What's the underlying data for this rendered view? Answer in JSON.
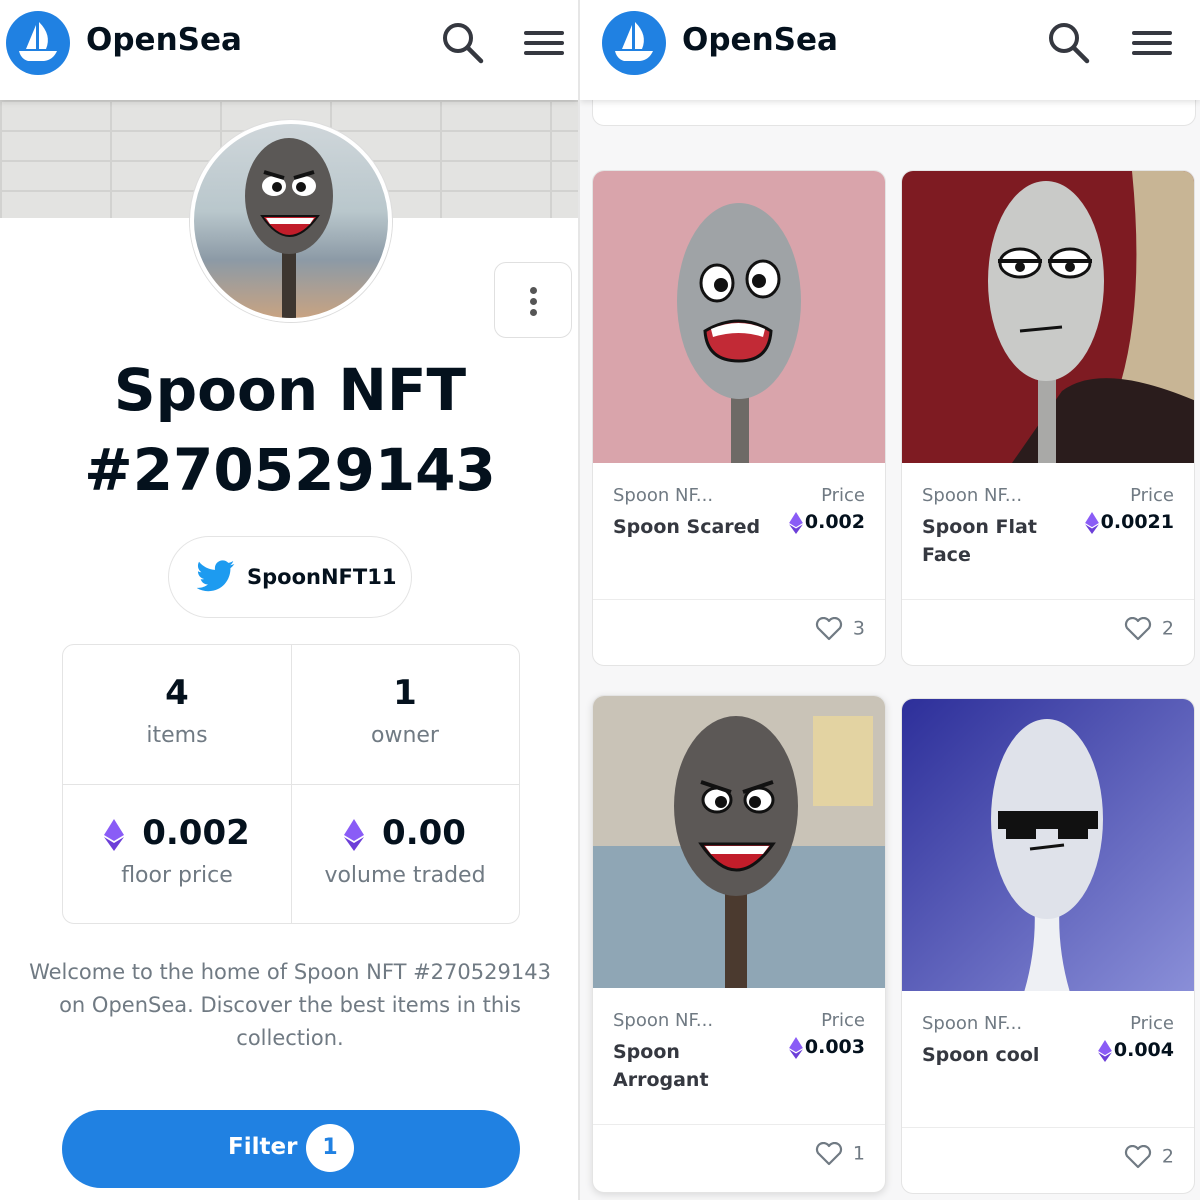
{
  "left": {
    "header": {
      "brand": "OpenSea"
    },
    "collection": {
      "title": "Spoon NFT #270529143",
      "twitter_handle": "SpoonNFT11",
      "stats": [
        {
          "value": "4",
          "label": "items"
        },
        {
          "value": "1",
          "label": "owner"
        },
        {
          "value": "0.002",
          "label": "floor price",
          "currency_icon": "ethereum-icon"
        },
        {
          "value": "0.00",
          "label": "volume traded",
          "currency_icon": "ethereum-icon"
        }
      ],
      "description": "Welcome to the home of Spoon NFT #270529143 on OpenSea. Discover the best items in this collection."
    },
    "filter": {
      "label": "Filter",
      "count": "1"
    }
  },
  "right": {
    "header": {
      "brand": "OpenSea"
    },
    "items": [
      {
        "collection": "Spoon NF...",
        "name": "Spoon Scared",
        "price_label": "Price",
        "price": "0.002",
        "likes": "3"
      },
      {
        "collection": "Spoon NF...",
        "name": "Spoon Flat Face",
        "price_label": "Price",
        "price": "0.0021",
        "likes": "2"
      },
      {
        "collection": "Spoon NF...",
        "name": "Spoon Arrogant",
        "price_label": "Price",
        "price": "0.003",
        "likes": "1"
      },
      {
        "collection": "Spoon NF...",
        "name": "Spoon cool",
        "price_label": "Price",
        "price": "0.004",
        "likes": "2"
      }
    ]
  },
  "colors": {
    "brand_blue": "#2081e2",
    "ethereum_purple": "#8a5cf6",
    "text_dark": "#04111d",
    "text_muted": "#707a83"
  },
  "icons": [
    "opensea-logo-icon",
    "search-icon",
    "menu-icon",
    "more-vertical-icon",
    "twitter-icon",
    "ethereum-icon",
    "heart-icon"
  ]
}
